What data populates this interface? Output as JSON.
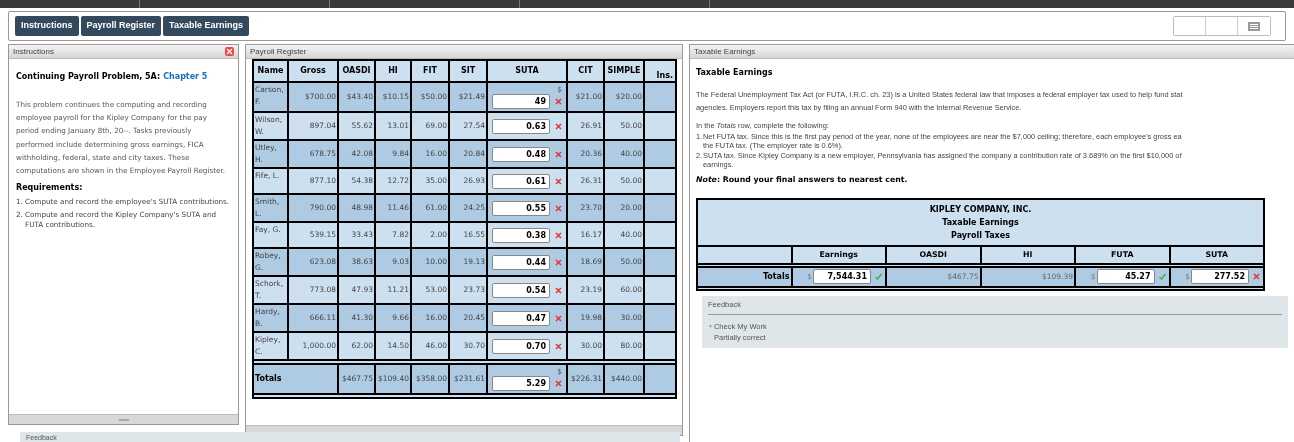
{
  "toolbar": {
    "tabs": [
      {
        "label": "Instructions",
        "selected": false
      },
      {
        "label": "Payroll Register",
        "selected": false
      },
      {
        "label": "Taxable Earnings",
        "selected": false
      }
    ]
  },
  "instructions": {
    "title": "Instructions",
    "heading": "Continuing Payroll Problem, 5A:",
    "heading_link": "Chapter 5",
    "paragraph": "This problem continues the computing and recording employee payroll for the Kipley Company for the pay period ending January 8th, 20--. Tasks previously performed include determining gross earnings, FICA withholding, federal, state and city taxes. These computations are shown in the Employee Payroll Register.",
    "requirements_heading": "Requirements:",
    "requirements": [
      {
        "number": "1.",
        "text": "Compute and record the employee's SUTA contributions."
      },
      {
        "number": "2.",
        "text": "Compute and record the Kipley Company's SUTA and FUTA contributions."
      }
    ]
  },
  "payroll_register": {
    "title": "Payroll Register",
    "columns": [
      "Name",
      "Gross",
      "OASDI",
      "HI",
      "FIT",
      "SIT",
      "SUTA",
      "CIT",
      "SIMPLE",
      "Ins."
    ],
    "rows": [
      {
        "name": "Carson, F.",
        "gross": "$700.00",
        "oasdi": "$43.40",
        "hi": "$10.15",
        "fit": "$50.00",
        "sit": "$21.49",
        "suta": {
          "currency": "$",
          "value": "49",
          "correct": false
        },
        "cit": "$21.00",
        "simple": "$20.00"
      },
      {
        "name": "Wilson, W.",
        "gross": "897.04",
        "oasdi": "55.62",
        "hi": "13.01",
        "fit": "69.00",
        "sit": "27.54",
        "suta": {
          "value": "0.63",
          "correct": false
        },
        "cit": "26.91",
        "simple": "50.00"
      },
      {
        "name": "Utley, H.",
        "gross": "678.75",
        "oasdi": "42.08",
        "hi": "9.84",
        "fit": "16.00",
        "sit": "20.84",
        "suta": {
          "value": "0.48",
          "correct": false
        },
        "cit": "20.36",
        "simple": "40.00"
      },
      {
        "name": "Fife, L.",
        "gross": "877.10",
        "oasdi": "54.38",
        "hi": "12.72",
        "fit": "35.00",
        "sit": "26.93",
        "suta": {
          "value": "0.61",
          "correct": false
        },
        "cit": "26.31",
        "simple": "50.00"
      },
      {
        "name": "Smith, L.",
        "gross": "790.00",
        "oasdi": "48.98",
        "hi": "11.46",
        "fit": "61.00",
        "sit": "24.25",
        "suta": {
          "value": "0.55",
          "correct": false
        },
        "cit": "23.70",
        "simple": "20.00"
      },
      {
        "name": "Fay, G.",
        "gross": "539.15",
        "oasdi": "33.43",
        "hi": "7.82",
        "fit": "2.00",
        "sit": "16.55",
        "suta": {
          "value": "0.38",
          "correct": false
        },
        "cit": "16.17",
        "simple": "40.00"
      },
      {
        "name": "Robey, G.",
        "gross": "623.08",
        "oasdi": "38.63",
        "hi": "9.03",
        "fit": "10.00",
        "sit": "19.13",
        "suta": {
          "value": "0.44",
          "correct": false
        },
        "cit": "18.69",
        "simple": "50.00"
      },
      {
        "name": "Schork, T.",
        "gross": "773.08",
        "oasdi": "47.93",
        "hi": "11.21",
        "fit": "53.00",
        "sit": "23.73",
        "suta": {
          "value": "0.54",
          "correct": false
        },
        "cit": "23.19",
        "simple": "60.00"
      },
      {
        "name": "Hardy, B.",
        "gross": "666.11",
        "oasdi": "41.30",
        "hi": "9.66",
        "fit": "16.00",
        "sit": "20.45",
        "suta": {
          "value": "0.47",
          "correct": false
        },
        "cit": "19.98",
        "simple": "30.00"
      },
      {
        "name": "Kipley, C.",
        "gross": "1,000.00",
        "oasdi": "62.00",
        "hi": "14.50",
        "fit": "46.00",
        "sit": "30.70",
        "suta": {
          "value": "0.70",
          "correct": false
        },
        "cit": "30.00",
        "simple": "80.00"
      }
    ],
    "totals": {
      "label": "Totals",
      "oasdi": "$467.75",
      "hi": "$109.40",
      "fit": "$358.00",
      "sit": "$231.61",
      "suta": {
        "currency": "$",
        "value": "5.29",
        "correct": false
      },
      "cit": "$226.31",
      "simple": "$440.00"
    }
  },
  "taxable_earnings": {
    "title": "Taxable Earnings",
    "heading": "Taxable Earnings",
    "intro_lines": [
      "The Federal Unemployment Tax Act (or FUTA, I.R.C. ch. 23) is a United States federal law that imposes a federal employer tax used to help fund stat",
      "agencies. Employers report this tax by filing an annual Form 940 with the Internal Revenue Service."
    ],
    "prompt": "In the *Totals* row, complete the following:",
    "steps": [
      {
        "number": "1.",
        "lines": [
          "Net FUTA tax. Since this is the first pay period of the year, none of the employees are near the $7,000 ceiling; therefore, each employee's gross ea",
          "the FUTA tax. (The employer rate is 0.6%)."
        ]
      },
      {
        "number": "2.",
        "lines": [
          "SUTA tax. Since Kipley Company is a new employer, Pennsylvania has assigned the company a contribution rate of 3.689% on the first $10,000 of",
          "earnings."
        ]
      }
    ],
    "note": "*Note*: Round your final answers to nearest cent.",
    "summary_table": {
      "title_lines": [
        "KIPLEY COMPANY, INC.",
        "Taxable Earnings",
        "Payroll Taxes"
      ],
      "columns": [
        "Earnings",
        "OASDI",
        "HI",
        "FUTA",
        "SUTA"
      ],
      "totals_label": "Totals",
      "cells": [
        {
          "kind": "input",
          "currency": "$",
          "value": "7,544.31",
          "correct": true
        },
        {
          "kind": "text",
          "value": "$467.75"
        },
        {
          "kind": "text",
          "value": "$109.39"
        },
        {
          "kind": "input",
          "currency": "$",
          "value": "45.27",
          "correct": true
        },
        {
          "kind": "input",
          "currency": "$",
          "value": "277.52",
          "correct": false
        }
      ]
    },
    "feedback": {
      "title": "Feedback",
      "toggle": "▼",
      "link": "Check My Work",
      "result": "Partially correct"
    }
  },
  "bottom_feedback": {
    "title": "Feedback"
  }
}
